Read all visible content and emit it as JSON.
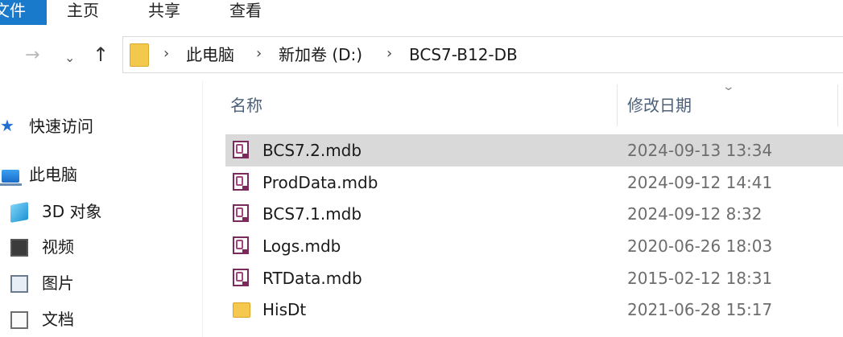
{
  "ribbon": {
    "file_tab": "文件",
    "tabs": [
      "主页",
      "共享",
      "查看"
    ]
  },
  "nav_buttons": {
    "forward": "→",
    "recent": "⌄",
    "up": "↑"
  },
  "address": {
    "breadcrumbs": [
      "此电脑",
      "新加卷 (D:)",
      "BCS7-B12-DB"
    ]
  },
  "navigation_pane": {
    "items": [
      {
        "label": "快速访问",
        "icon": "star-icon"
      },
      {
        "label": "此电脑",
        "icon": "computer-icon"
      },
      {
        "label": "3D 对象",
        "icon": "3d-objects-icon"
      },
      {
        "label": "视频",
        "icon": "video-icon"
      },
      {
        "label": "图片",
        "icon": "pictures-icon"
      },
      {
        "label": "文档",
        "icon": "documents-icon"
      }
    ]
  },
  "file_list": {
    "columns": {
      "name": "名称",
      "modified": "修改日期"
    },
    "rows": [
      {
        "name": "BCS7.2.mdb",
        "modified": "2024-09-13 13:34",
        "type": "mdb",
        "selected": true
      },
      {
        "name": "ProdData.mdb",
        "modified": "2024-09-12 14:41",
        "type": "mdb",
        "selected": false
      },
      {
        "name": "BCS7.1.mdb",
        "modified": "2024-09-12 8:32",
        "type": "mdb",
        "selected": false
      },
      {
        "name": "Logs.mdb",
        "modified": "2020-06-26 18:03",
        "type": "mdb",
        "selected": false
      },
      {
        "name": "RTData.mdb",
        "modified": "2015-02-12 18:31",
        "type": "mdb",
        "selected": false
      },
      {
        "name": "HisDt",
        "modified": "2021-06-28 15:17",
        "type": "folder",
        "selected": false
      }
    ]
  },
  "colors": {
    "file_tab_bg": "#1979ca",
    "selected_row_bg": "#d9d9d9",
    "header_text": "#4c607a"
  }
}
